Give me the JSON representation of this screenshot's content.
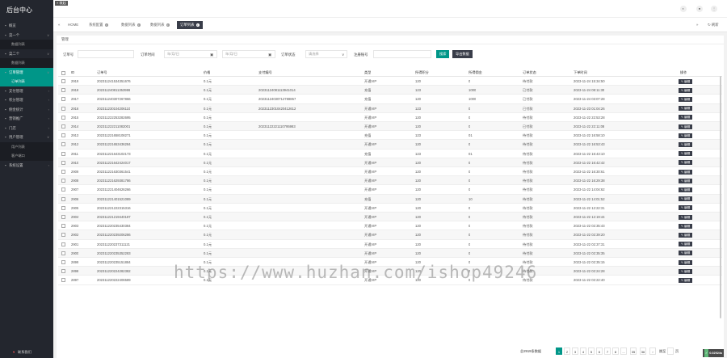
{
  "sidebar": {
    "logo": "后台中心",
    "items": [
      {
        "label": "概览",
        "type": "item"
      },
      {
        "label": "菜一个",
        "type": "item",
        "arrow": "∨"
      },
      {
        "label": "数据列表",
        "type": "sub"
      },
      {
        "label": "菜二个",
        "type": "item",
        "arrow": "∨"
      },
      {
        "label": "数据列表",
        "type": "sub"
      },
      {
        "label": "订单管理",
        "type": "item",
        "arrow": "∨",
        "highlight": true
      },
      {
        "label": "订单列表",
        "type": "sub",
        "active": true
      },
      {
        "label": "支付管理",
        "type": "item",
        "arrow": "‹"
      },
      {
        "label": "积分管理",
        "type": "item",
        "arrow": "‹"
      },
      {
        "label": "佣金统计",
        "type": "item",
        "arrow": "‹"
      },
      {
        "label": "营销推广",
        "type": "item",
        "arrow": "‹"
      },
      {
        "label": "门店",
        "type": "item",
        "arrow": "‹"
      },
      {
        "label": "用户管理",
        "type": "item",
        "arrow": "∨"
      },
      {
        "label": "用户列表",
        "type": "sub"
      },
      {
        "label": "客户端口",
        "type": "sub"
      },
      {
        "label": "系统设置",
        "type": "item",
        "arrow": "‹"
      }
    ],
    "footer": "联系我们"
  },
  "header": {
    "back": "« 收起"
  },
  "tabs": {
    "home": "HOME",
    "items": [
      "系统配置",
      "数据列表",
      "数据列表",
      "订单列表"
    ],
    "right_label": "刷新"
  },
  "breadcrumb": "管理",
  "filters": {
    "order_no_label": "订单号",
    "order_no_placeholder": "",
    "order_time_label": "订单时间",
    "start_placeholder": "年/月/日",
    "end_placeholder": "年/月/日",
    "status_label": "订单状态",
    "status_value": "请选择",
    "mobile_label": "注册账号",
    "search_btn": "搜索",
    "export_btn": "导出数据"
  },
  "table": {
    "headers": [
      "ID",
      "订单号",
      "价格",
      "支付编号",
      "类型",
      "所得积分",
      "所得佣金",
      "订单状态",
      "下单时间",
      "操作"
    ],
    "edit_label": "✎ 编辑",
    "rows": [
      [
        "2919",
        "202311241534351676",
        "0.1元",
        "",
        "开通VIP",
        "120",
        "0",
        "待付款",
        "2023-11-24 15:34:50"
      ],
      [
        "2918",
        "202311240811353986",
        "0.1元",
        "20231124081113941014",
        "充值",
        "123",
        "1000",
        "已付款",
        "2023-11-24 08:11:30"
      ],
      [
        "2917",
        "202311240307267866",
        "0.1元",
        "20231124030712788857",
        "充值",
        "120",
        "1000",
        "已付款",
        "2023-11-24 03:07:28"
      ],
      [
        "2916",
        "202311230104206110",
        "0.1元",
        "20231123010420412612",
        "开通VIP",
        "123",
        "0",
        "已付款",
        "2023-11-23 01:04:26"
      ],
      [
        "2915",
        "202311222253282695",
        "0.1元",
        "",
        "开通VIP",
        "120",
        "0",
        "待付款",
        "2023-11-22 22:53:28"
      ],
      [
        "2914",
        "202311222211082001",
        "0.1元",
        "20231122221110795983",
        "开通VIP",
        "120",
        "0",
        "已付款",
        "2023-11-22 22:11:08"
      ],
      [
        "2913",
        "202311221658108271",
        "0.1元",
        "",
        "充值",
        "123",
        "01",
        "待付款",
        "2023-11-22 16:58:10"
      ],
      [
        "2912",
        "202311221653436284",
        "0.1元",
        "",
        "开通VIP",
        "120",
        "0",
        "待付款",
        "2023-11-22 16:53:43"
      ],
      [
        "2911",
        "202311221643102173",
        "0.1元",
        "",
        "充值",
        "123",
        "01",
        "待付款",
        "2023-11-22 16:43:10"
      ],
      [
        "2910",
        "202311221642424017",
        "0.1元",
        "",
        "开通VIP",
        "120",
        "0",
        "待付款",
        "2023-11-22 16:42:42"
      ],
      [
        "2909",
        "202311221630361541",
        "0.1元",
        "",
        "开通VIP",
        "120",
        "0",
        "待付款",
        "2023-11-22 16:30:61"
      ],
      [
        "2908",
        "202311221629381786",
        "0.1元",
        "",
        "开通VIP",
        "120",
        "0",
        "待付款",
        "2023-11-22 16:29:38"
      ],
      [
        "2907",
        "202311221404626266",
        "0.1元",
        "",
        "开通VIP",
        "120",
        "0",
        "待付款",
        "2023-11-22 14:04:62"
      ],
      [
        "2906",
        "202311221401521089",
        "0.1元",
        "",
        "充值",
        "120",
        "10",
        "待付款",
        "2023-11-22 14:01:52"
      ],
      [
        "2905",
        "202311221222315316",
        "0.1元",
        "",
        "开通VIP",
        "120",
        "0",
        "待付款",
        "2023-11-22 12:22:31"
      ],
      [
        "2904",
        "202311221219440187",
        "0.1元",
        "",
        "开通VIP",
        "120",
        "0",
        "待付款",
        "2023-11-22 12:19:44"
      ],
      [
        "2903",
        "202311220235430384",
        "0.1元",
        "",
        "开通VIP",
        "120",
        "0",
        "待付款",
        "2023-11-22 02:35:43"
      ],
      [
        "2902",
        "202311220239206286",
        "0.1元",
        "",
        "开通VIP",
        "120",
        "0",
        "待付款",
        "2023-11-22 02:39:20"
      ],
      [
        "2901",
        "202311220237311121",
        "0.1元",
        "",
        "开通VIP",
        "120",
        "0",
        "待付款",
        "2023-11-22 02:37:31"
      ],
      [
        "2900",
        "202311220235352283",
        "0.1元",
        "",
        "开通VIP",
        "120",
        "0",
        "待付款",
        "2023-11-22 02:35:35"
      ],
      [
        "2899",
        "202311220235151884",
        "0.1元",
        "",
        "开通VIP",
        "120",
        "0",
        "待付款",
        "2023-11-22 02:35:15"
      ],
      [
        "2898",
        "202311220224282382",
        "0.1元",
        "",
        "开通VIP",
        "120",
        "0",
        "待付款",
        "2023-11-22 02:24:28"
      ],
      [
        "2897",
        "202311220222406589",
        "0.1元",
        "",
        "开通VIP",
        "120",
        "0",
        "待付款",
        "2023-11-22 02:22:40"
      ]
    ]
  },
  "pagination": {
    "total_text": "总2919条数据",
    "pages": [
      "1",
      "2",
      "3",
      "4",
      "5",
      "6",
      "7",
      "8",
      "...",
      "35",
      "36"
    ],
    "next": "›",
    "goto_label": "跳至",
    "page_label": "页"
  },
  "status_badge": {
    "left": "✓",
    "right": "0.02924s"
  },
  "watermark": "https://www.huzhan.com/ishop49246"
}
